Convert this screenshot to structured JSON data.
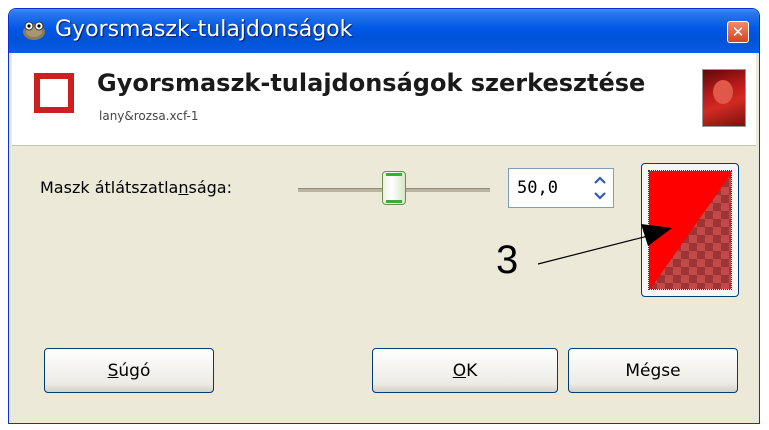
{
  "window": {
    "title": "Gyorsmaszk-tulajdonságok",
    "close_symbol": "✕"
  },
  "header": {
    "title": "Gyorsmaszk-tulajdonságok szerkesztése",
    "subtitle": "lany&rozsa.xcf-1"
  },
  "opacity": {
    "label_before": "Maszk átlátszatla",
    "label_mnemonic": "n",
    "label_after": "sága:",
    "value": "50,0",
    "slider_fraction": 0.5
  },
  "swatch": {
    "color": "#ff0000"
  },
  "annotation": {
    "number": "3"
  },
  "buttons": {
    "help_mnemonic": "S",
    "help_rest": "úgó",
    "ok_mnemonic": "O",
    "ok_rest": "K",
    "cancel": "Mégse"
  },
  "icons": {
    "title": "gimp-mascot-icon",
    "close": "close-icon",
    "header": "quick-mask-icon",
    "spin_up": "chevron-up-icon",
    "spin_down": "chevron-down-icon"
  }
}
